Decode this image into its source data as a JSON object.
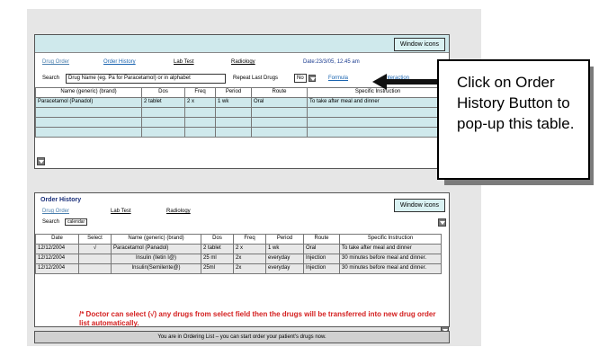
{
  "top_panel": {
    "window_button": "Window icons",
    "tabs": {
      "drug_order": "Drug Order",
      "order_history": "Order History",
      "lab_test": "Lab Test",
      "radiology": "Radiology",
      "date": "Date:23/3/05, 12.45 am"
    },
    "search_label": "Search",
    "search_value": "Drug Name (eg. Pa for Paracetamol) or in alphabet",
    "repeat_label": "Repeat Last Drugs",
    "repeat_value": "No",
    "formula_link": "Formula",
    "interaction_link": "Interaction",
    "columns": [
      "Name (generic) (brand)",
      "Dos",
      "Freq",
      "Period",
      "Route",
      "Specific Instruction"
    ],
    "rows": [
      [
        "Paracetamol (Panadol)",
        "2 tablet",
        "2 x",
        "1 wk",
        "Oral",
        "To take after meal and dinner"
      ],
      [
        "",
        "",
        "",
        "",
        "",
        ""
      ],
      [
        "",
        "",
        "",
        "",
        "",
        ""
      ],
      [
        "",
        "",
        "",
        "",
        "",
        ""
      ]
    ]
  },
  "callout": {
    "text": "Click on Order History Button to pop-up this table."
  },
  "bottom_panel": {
    "title": "Order History",
    "window_button": "Window icons",
    "tabs": {
      "drug_order": "Drug Order",
      "lab_test": "Lab Test",
      "radiology": "Radiology"
    },
    "search_label": "Search",
    "calendar_value": "calendar",
    "columns": [
      "Date",
      "Select",
      "Name (generic) (brand)",
      "Dos",
      "Freq",
      "Period",
      "Route",
      "Specific Instruction"
    ],
    "rows": [
      [
        "12/12/2004",
        "√",
        "Paracetamol (Panadol)",
        "2 tablet",
        "2 x",
        "1 wk",
        "Oral",
        "To take after meal and dinner"
      ],
      [
        "12/12/2004",
        "",
        "Insulin (Iletin I@)",
        "25 ml",
        "2x",
        "everyday",
        "Injection",
        "30 minutes before meal and dinner."
      ],
      [
        "12/12/2004",
        "",
        "Insulin(Semilente@)",
        "25ml",
        "2x",
        "everyday",
        "Injection",
        "30 minutes before meal and dinner."
      ]
    ],
    "note": "/* Doctor can select (√) any drugs from select field then the drugs will be transferred into new drug order list automatically."
  },
  "status_bar": "You are in Ordering List – you can start order your patient's drugs now.",
  "colors": {
    "titlebar": "#cfe9ec",
    "note_red": "#d42020",
    "link_blue": "#1a64b0"
  }
}
